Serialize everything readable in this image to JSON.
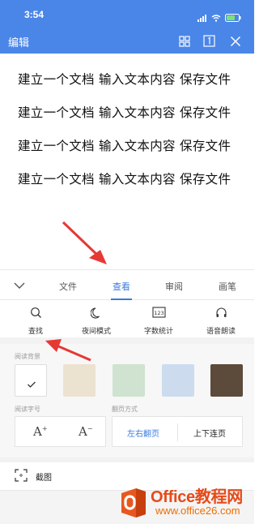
{
  "status_bar": {
    "time": "3:54"
  },
  "header": {
    "title": "编辑"
  },
  "document": {
    "lines": [
      "建立一个文档 输入文本内容 保存文件",
      "建立一个文档 输入文本内容 保存文件",
      "建立一个文档 输入文本内容 保存文件",
      "建立一个文档 输入文本内容 保存文件"
    ]
  },
  "ribbon": {
    "tabs": [
      {
        "label": "文件",
        "active": false
      },
      {
        "label": "查看",
        "active": true
      },
      {
        "label": "审阅",
        "active": false
      },
      {
        "label": "画笔",
        "active": false
      }
    ]
  },
  "tools": [
    {
      "label": "查找",
      "icon": "search-icon"
    },
    {
      "label": "夜间模式",
      "icon": "moon-icon"
    },
    {
      "label": "字数统计",
      "icon": "word-count-icon"
    },
    {
      "label": "语音朗读",
      "icon": "headphones-icon"
    }
  ],
  "reading_background": {
    "label": "阅读背景",
    "swatches": [
      "#ffffff",
      "#ece2d0",
      "#cfe3d0",
      "#ccdcee",
      "#5c4a3b"
    ],
    "selected_index": 0
  },
  "font_size": {
    "label": "阅读字号",
    "increase_glyph": "A",
    "decrease_glyph": "A"
  },
  "page_turn": {
    "label": "翻页方式",
    "options": [
      "左右翻页",
      "上下连页"
    ],
    "selected_index": 0
  },
  "screenshot": {
    "label": "截图"
  },
  "watermark": {
    "brand": "Office教程网",
    "url": "www.office26.com"
  },
  "colors": {
    "accent": "#3a7be0",
    "header": "#4a86e8",
    "annotation_arrow": "#e53935"
  }
}
